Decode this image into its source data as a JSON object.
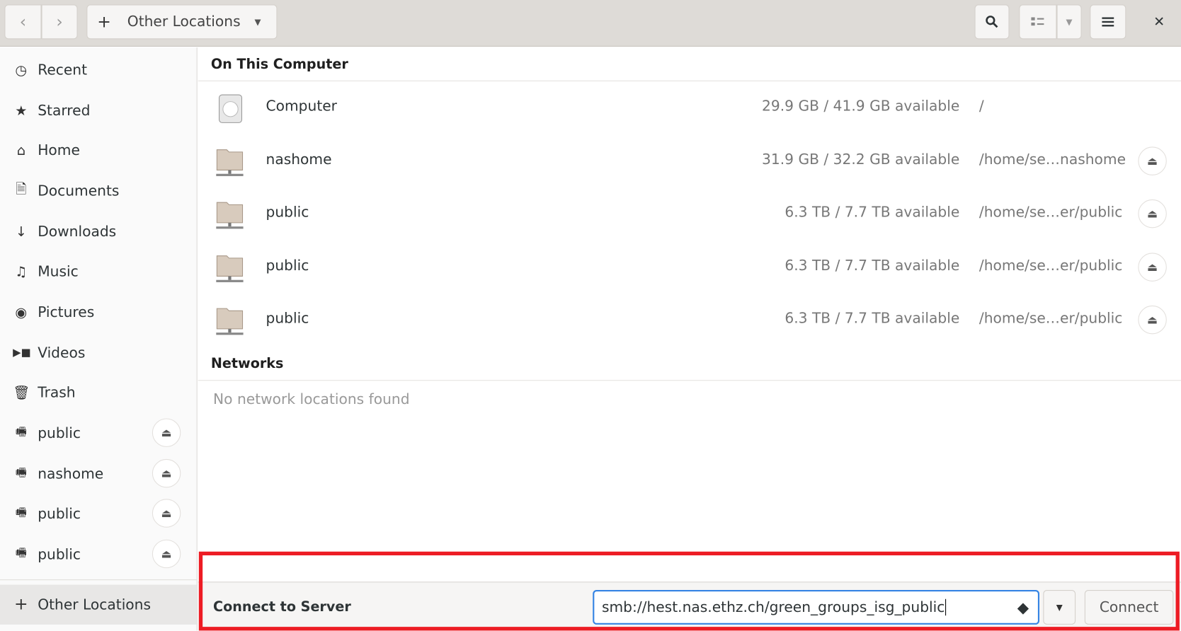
{
  "header": {
    "location_label": "Other Locations",
    "icons": {
      "back": "chevron-left-icon",
      "forward": "chevron-right-icon",
      "new": "plus-icon",
      "search": "search-icon",
      "view": "list-view-icon",
      "menu": "hamburger-icon",
      "close": "close-icon"
    }
  },
  "sidebar": {
    "items": [
      {
        "label": "Recent",
        "icon": "clock-icon"
      },
      {
        "label": "Starred",
        "icon": "star-icon"
      },
      {
        "label": "Home",
        "icon": "home-icon"
      },
      {
        "label": "Documents",
        "icon": "document-icon"
      },
      {
        "label": "Downloads",
        "icon": "download-icon"
      },
      {
        "label": "Music",
        "icon": "music-icon"
      },
      {
        "label": "Pictures",
        "icon": "camera-icon"
      },
      {
        "label": "Videos",
        "icon": "video-icon"
      },
      {
        "label": "Trash",
        "icon": "trash-icon"
      }
    ],
    "mounts": [
      {
        "label": "public"
      },
      {
        "label": "nashome"
      },
      {
        "label": "public"
      },
      {
        "label": "public"
      }
    ],
    "other_locations": "Other Locations"
  },
  "main": {
    "on_this_computer": "On This Computer",
    "rows": [
      {
        "name": "Computer",
        "size": "29.9 GB / 41.9 GB available",
        "path": "/",
        "eject": false
      },
      {
        "name": "nashome",
        "size": "31.9 GB / 32.2 GB available",
        "path": "/home/se…nashome",
        "eject": true
      },
      {
        "name": "public",
        "size": "6.3 TB / 7.7 TB available",
        "path": "/home/se…er/public",
        "eject": true
      },
      {
        "name": "public",
        "size": "6.3 TB / 7.7 TB available",
        "path": "/home/se…er/public",
        "eject": true
      },
      {
        "name": "public",
        "size": "6.3 TB / 7.7 TB available",
        "path": "/home/se…er/public",
        "eject": true
      }
    ],
    "networks": "Networks",
    "no_networks": "No network locations found"
  },
  "connect": {
    "label": "Connect to Server",
    "value": "smb://hest.nas.ethz.ch/green_groups_isg_public",
    "button": "Connect"
  },
  "colors": {
    "accent": "#3584e4",
    "highlight_box": "#ed1c24"
  }
}
